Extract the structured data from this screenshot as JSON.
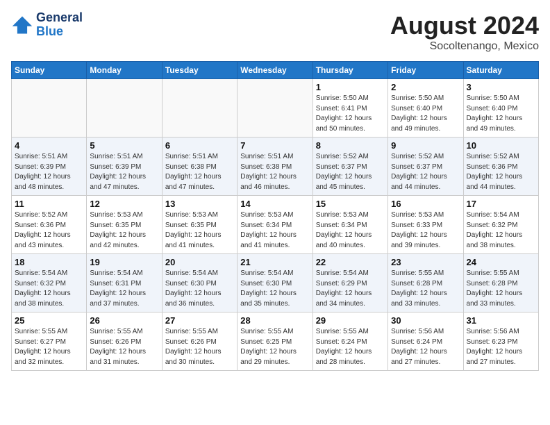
{
  "header": {
    "logo_line1": "General",
    "logo_line2": "Blue",
    "month": "August 2024",
    "location": "Socoltenango, Mexico"
  },
  "weekdays": [
    "Sunday",
    "Monday",
    "Tuesday",
    "Wednesday",
    "Thursday",
    "Friday",
    "Saturday"
  ],
  "weeks": [
    [
      {
        "day": "",
        "info": ""
      },
      {
        "day": "",
        "info": ""
      },
      {
        "day": "",
        "info": ""
      },
      {
        "day": "",
        "info": ""
      },
      {
        "day": "1",
        "info": "Sunrise: 5:50 AM\nSunset: 6:41 PM\nDaylight: 12 hours\nand 50 minutes."
      },
      {
        "day": "2",
        "info": "Sunrise: 5:50 AM\nSunset: 6:40 PM\nDaylight: 12 hours\nand 49 minutes."
      },
      {
        "day": "3",
        "info": "Sunrise: 5:50 AM\nSunset: 6:40 PM\nDaylight: 12 hours\nand 49 minutes."
      }
    ],
    [
      {
        "day": "4",
        "info": "Sunrise: 5:51 AM\nSunset: 6:39 PM\nDaylight: 12 hours\nand 48 minutes."
      },
      {
        "day": "5",
        "info": "Sunrise: 5:51 AM\nSunset: 6:39 PM\nDaylight: 12 hours\nand 47 minutes."
      },
      {
        "day": "6",
        "info": "Sunrise: 5:51 AM\nSunset: 6:38 PM\nDaylight: 12 hours\nand 47 minutes."
      },
      {
        "day": "7",
        "info": "Sunrise: 5:51 AM\nSunset: 6:38 PM\nDaylight: 12 hours\nand 46 minutes."
      },
      {
        "day": "8",
        "info": "Sunrise: 5:52 AM\nSunset: 6:37 PM\nDaylight: 12 hours\nand 45 minutes."
      },
      {
        "day": "9",
        "info": "Sunrise: 5:52 AM\nSunset: 6:37 PM\nDaylight: 12 hours\nand 44 minutes."
      },
      {
        "day": "10",
        "info": "Sunrise: 5:52 AM\nSunset: 6:36 PM\nDaylight: 12 hours\nand 44 minutes."
      }
    ],
    [
      {
        "day": "11",
        "info": "Sunrise: 5:52 AM\nSunset: 6:36 PM\nDaylight: 12 hours\nand 43 minutes."
      },
      {
        "day": "12",
        "info": "Sunrise: 5:53 AM\nSunset: 6:35 PM\nDaylight: 12 hours\nand 42 minutes."
      },
      {
        "day": "13",
        "info": "Sunrise: 5:53 AM\nSunset: 6:35 PM\nDaylight: 12 hours\nand 41 minutes."
      },
      {
        "day": "14",
        "info": "Sunrise: 5:53 AM\nSunset: 6:34 PM\nDaylight: 12 hours\nand 41 minutes."
      },
      {
        "day": "15",
        "info": "Sunrise: 5:53 AM\nSunset: 6:34 PM\nDaylight: 12 hours\nand 40 minutes."
      },
      {
        "day": "16",
        "info": "Sunrise: 5:53 AM\nSunset: 6:33 PM\nDaylight: 12 hours\nand 39 minutes."
      },
      {
        "day": "17",
        "info": "Sunrise: 5:54 AM\nSunset: 6:32 PM\nDaylight: 12 hours\nand 38 minutes."
      }
    ],
    [
      {
        "day": "18",
        "info": "Sunrise: 5:54 AM\nSunset: 6:32 PM\nDaylight: 12 hours\nand 38 minutes."
      },
      {
        "day": "19",
        "info": "Sunrise: 5:54 AM\nSunset: 6:31 PM\nDaylight: 12 hours\nand 37 minutes."
      },
      {
        "day": "20",
        "info": "Sunrise: 5:54 AM\nSunset: 6:30 PM\nDaylight: 12 hours\nand 36 minutes."
      },
      {
        "day": "21",
        "info": "Sunrise: 5:54 AM\nSunset: 6:30 PM\nDaylight: 12 hours\nand 35 minutes."
      },
      {
        "day": "22",
        "info": "Sunrise: 5:54 AM\nSunset: 6:29 PM\nDaylight: 12 hours\nand 34 minutes."
      },
      {
        "day": "23",
        "info": "Sunrise: 5:55 AM\nSunset: 6:28 PM\nDaylight: 12 hours\nand 33 minutes."
      },
      {
        "day": "24",
        "info": "Sunrise: 5:55 AM\nSunset: 6:28 PM\nDaylight: 12 hours\nand 33 minutes."
      }
    ],
    [
      {
        "day": "25",
        "info": "Sunrise: 5:55 AM\nSunset: 6:27 PM\nDaylight: 12 hours\nand 32 minutes."
      },
      {
        "day": "26",
        "info": "Sunrise: 5:55 AM\nSunset: 6:26 PM\nDaylight: 12 hours\nand 31 minutes."
      },
      {
        "day": "27",
        "info": "Sunrise: 5:55 AM\nSunset: 6:26 PM\nDaylight: 12 hours\nand 30 minutes."
      },
      {
        "day": "28",
        "info": "Sunrise: 5:55 AM\nSunset: 6:25 PM\nDaylight: 12 hours\nand 29 minutes."
      },
      {
        "day": "29",
        "info": "Sunrise: 5:55 AM\nSunset: 6:24 PM\nDaylight: 12 hours\nand 28 minutes."
      },
      {
        "day": "30",
        "info": "Sunrise: 5:56 AM\nSunset: 6:24 PM\nDaylight: 12 hours\nand 27 minutes."
      },
      {
        "day": "31",
        "info": "Sunrise: 5:56 AM\nSunset: 6:23 PM\nDaylight: 12 hours\nand 27 minutes."
      }
    ]
  ]
}
